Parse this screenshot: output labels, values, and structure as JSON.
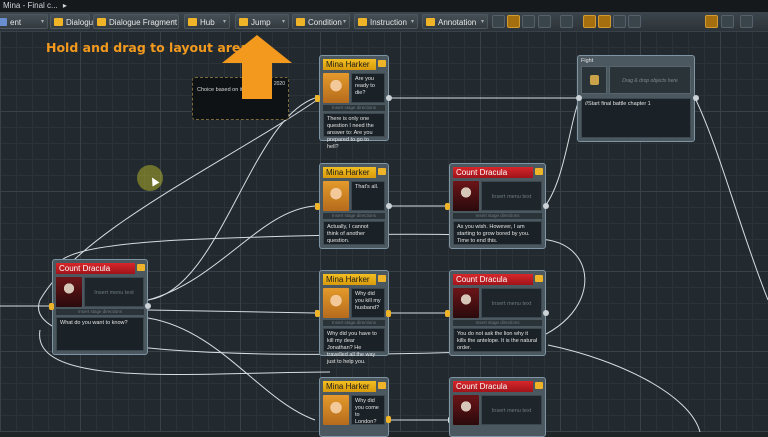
{
  "window": {
    "title": "Mina - Final c..."
  },
  "toolbar": {
    "buttons": [
      {
        "label": "ent",
        "icon": "entity-icon",
        "color": "#6a8fd0"
      },
      {
        "label": "Dialogue",
        "icon": "dialogue-icon",
        "color": "#f0b429"
      },
      {
        "label": "Dialogue Fragment",
        "icon": "dialogue-fragment-icon",
        "color": "#f0b429"
      },
      {
        "label": "Hub",
        "icon": "hub-icon",
        "color": "#f0b429"
      },
      {
        "label": "Jump",
        "icon": "jump-icon",
        "color": "#f0b429"
      },
      {
        "label": "Condition",
        "icon": "condition-icon",
        "color": "#f0b429"
      },
      {
        "label": "Instruction",
        "icon": "instruction-icon",
        "color": "#f0b429"
      },
      {
        "label": "Annotation",
        "icon": "annotation-icon",
        "color": "#f0b429"
      }
    ]
  },
  "overlay": {
    "hint": "Hold and drag to layout area"
  },
  "choice_box": {
    "text": "Choice based on ite",
    "number": "2020"
  },
  "fight_node": {
    "label": "Fight",
    "drop_hint": "Drag & drop objects here",
    "body": "//Start final battle chapter 1"
  },
  "nodes": {
    "mina1": {
      "speaker": "Mina Harker",
      "menu": "Are you ready to die?",
      "stage": "Insert stage directions",
      "text": "There is only one question I need the answer to: Are you prepared to go to hell?"
    },
    "mina2": {
      "speaker": "Mina Harker",
      "menu": "That's all.",
      "stage": "Insert stage directions",
      "text": "Actually, I cannot think of another question."
    },
    "drac2": {
      "speaker": "Count Dracula",
      "menu": "Insert menu text",
      "stage": "Insert stage directions",
      "text": "As you wish. However, I am starting to grow bored by you. Time to end this."
    },
    "drac_left": {
      "speaker": "Count Dracula",
      "menu": "Insert menu text",
      "stage": "Insert stage directions",
      "text": "What do you want to know?"
    },
    "mina3": {
      "speaker": "Mina Harker",
      "menu": "Why did you kill my husband?",
      "stage": "Insert stage directions",
      "text": "Why did you have to kill my dear Jonathan? He travelled all the way just to help you."
    },
    "drac3": {
      "speaker": "Count Dracula",
      "menu": "Insert menu text",
      "stage": "Insert stage directions",
      "text": "You do not ask the lion why it kills the antelope. It is the natural order."
    },
    "mina4": {
      "speaker": "Mina Harker",
      "menu": "Why did you come to London?",
      "stage": "Insert stage directions",
      "text": ""
    },
    "drac4": {
      "speaker": "Count Dracula",
      "menu": "Insert menu text",
      "stage": "",
      "text": ""
    }
  }
}
